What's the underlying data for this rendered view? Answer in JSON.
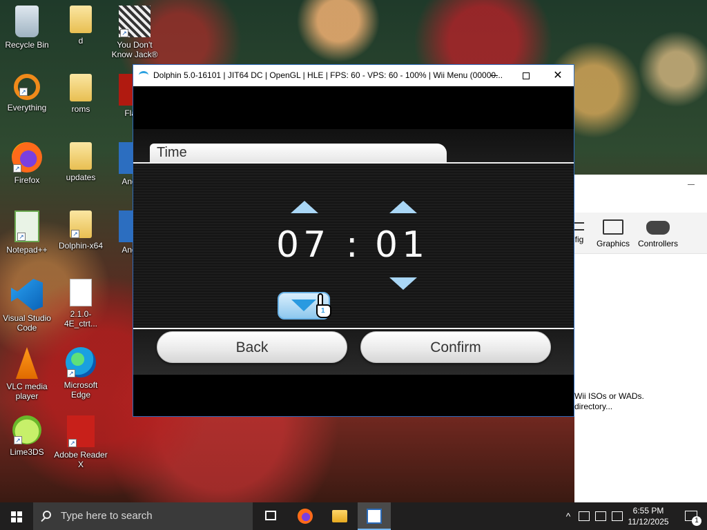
{
  "desktop": {
    "icons": [
      {
        "label": "Recycle Bin",
        "icon": "recycle-bin-icon"
      },
      {
        "label": "d",
        "icon": "folder-icon"
      },
      {
        "label": "You Don't Know Jack®",
        "icon": "game-icon"
      },
      {
        "label": "Everything",
        "icon": "search-magnifier-icon"
      },
      {
        "label": "roms",
        "icon": "folder-icon"
      },
      {
        "label": "Flash",
        "icon": "flash-icon"
      },
      {
        "label": "Firefox",
        "icon": "firefox-icon"
      },
      {
        "label": "updates",
        "icon": "folder-icon"
      },
      {
        "label": "Angr R",
        "icon": "angry-birds-icon"
      },
      {
        "label": "Notepad++",
        "icon": "notepadpp-icon"
      },
      {
        "label": "Dolphin-x64",
        "icon": "folder-icon"
      },
      {
        "label": "Angr R",
        "icon": "angry-birds-icon"
      },
      {
        "label": "Visual Studio Code",
        "icon": "vscode-icon"
      },
      {
        "label": "2.1.0-4E_ctrt...",
        "icon": "file-icon"
      },
      {
        "label": "VLC media player",
        "icon": "vlc-icon"
      },
      {
        "label": "Microsoft Edge",
        "icon": "edge-icon"
      },
      {
        "label": "Lime3DS",
        "icon": "lime3ds-icon"
      },
      {
        "label": "Adobe Reader X",
        "icon": "adobe-reader-icon"
      }
    ]
  },
  "dolphin_main": {
    "toolbar": [
      {
        "label": "fig",
        "icon": "config-icon"
      },
      {
        "label": "Graphics",
        "icon": "monitor-icon"
      },
      {
        "label": "Controllers",
        "icon": "gamepad-icon"
      }
    ],
    "empty_line1": "Wii ISOs or WADs.",
    "empty_line2": "directory..."
  },
  "emu_window": {
    "title": "Dolphin 5.0-16101 | JIT64 DC | OpenGL | HLE | FPS: 60 - VPS: 60 - 100% | Wii Menu (00000...",
    "controls": {
      "minimize": "minimize",
      "maximize": "maximize",
      "close": "✕"
    }
  },
  "wii_screen": {
    "tab_title": "Time",
    "hours": "07",
    "separator": ":",
    "minutes": "01",
    "cursor_player": "1",
    "back_label": "Back",
    "confirm_label": "Confirm",
    "accent_color": "#a9d6f5"
  },
  "taskbar": {
    "search_placeholder": "Type here to search",
    "apps": [
      "task-view",
      "firefox",
      "file-explorer",
      "dolphin"
    ],
    "time": "6:55 PM",
    "date": "11/12/2025",
    "notification_count": "1"
  }
}
